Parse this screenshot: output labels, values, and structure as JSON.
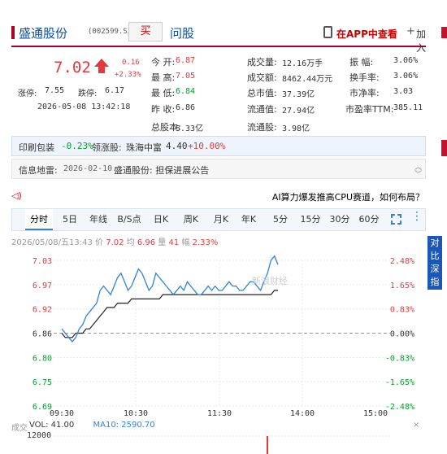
{
  "header": {
    "stock_name": "盛通股份",
    "stock_code": "(002599.SZ)",
    "buy_label": "买",
    "guba_label": "问股",
    "app_link": "在APP中查看",
    "add_label": "加入",
    "add_icon": "+"
  },
  "quote": {
    "price": "7.02",
    "change": "0.16",
    "change_pct": "+2.33%",
    "limit_up_label": "涨停:",
    "limit_up": "7.55",
    "limit_down_label": "跌停:",
    "limit_down": "6.17",
    "datetime": "2026-05-08 13:42:18",
    "fields": [
      {
        "label": "今    开:",
        "value": "6.87",
        "color": "red"
      },
      {
        "label": "最    高:",
        "value": "7.05",
        "color": "red"
      },
      {
        "label": "最    低:",
        "value": "6.84",
        "color": "green"
      },
      {
        "label": "昨    收:",
        "value": "6.86",
        "color": "normal"
      },
      {
        "label": "总股本:",
        "value": "5.33亿",
        "color": "normal"
      },
      {
        "label": "成交量:",
        "value": "12.16万手",
        "color": "normal"
      },
      {
        "label": "成交额:",
        "value": "8462.44万元",
        "color": "normal"
      },
      {
        "label": "总市值:",
        "value": "37.39亿",
        "color": "normal"
      },
      {
        "label": "流通值:",
        "value": "27.94亿",
        "color": "normal"
      },
      {
        "label": "流通股:",
        "value": "3.98亿",
        "color": "normal"
      },
      {
        "label": "振    幅:",
        "value": "3.06%",
        "color": "normal"
      },
      {
        "label": "换手率:",
        "value": "3.06%",
        "color": "normal"
      },
      {
        "label": "市净率:",
        "value": "3.03",
        "color": "normal"
      },
      {
        "label": "市盈率TTM:",
        "value": "385.11",
        "color": "normal"
      }
    ]
  },
  "industry": {
    "name": "印刷包装",
    "change": "-0.23%",
    "leader_label": "领涨股:",
    "leader_name": "珠海中富",
    "leader_price": "4.40",
    "leader_change": "+10.00%"
  },
  "news": {
    "label": "信息地雷:",
    "date": "2026-02-10",
    "title": "盛通股份: 担保进展公告",
    "chevron_up": "︿",
    "chevron_down": "﹀"
  },
  "ai_banner": "AI算力爆发推高CPU赛道，如何布局？",
  "speaker_icon": "◁)",
  "tabs": [
    "分时",
    "5日",
    "年线",
    "B/S点",
    "日K",
    "周K",
    "月K",
    "年K",
    "5分",
    "15分",
    "30分",
    "60分"
  ],
  "info_line": {
    "date": "2026/05/08/五13:43",
    "price_label": "价",
    "price": "7.02",
    "avg_label": "均",
    "avg": "6.96",
    "vol_label": "量",
    "vol": "41",
    "pct_label": "幅",
    "pct": "2.33%"
  },
  "float_button": "对比深指",
  "volume": {
    "label": "成交",
    "vol_text": "VOL: 41.00",
    "ma_text": "MA10: 2590.70",
    "max_label": "12000",
    "close_icon": "×"
  },
  "watermark": "新浪财经",
  "chart_data": {
    "type": "line",
    "y_left": [
      "7.03",
      "6.97",
      "6.92",
      "6.86",
      "6.80",
      "6.75",
      "6.69"
    ],
    "y_right": [
      "2.48%",
      "1.65%",
      "0.83%",
      "0.00%",
      "-0.83%",
      "-1.65%",
      "-2.48%"
    ],
    "x_labels": [
      "09:30",
      "10:30",
      "11:30",
      "14:00",
      "15:00"
    ],
    "ylim": [
      6.69,
      7.03
    ],
    "prev_close": 6.86,
    "series": [
      {
        "name": "价",
        "color": "#2f82d8",
        "values": [
          6.87,
          6.86,
          6.85,
          6.84,
          6.85,
          6.87,
          6.88,
          6.9,
          6.91,
          6.92,
          6.93,
          6.96,
          6.97,
          6.96,
          6.95,
          6.97,
          6.99,
          7.0,
          6.98,
          6.96,
          6.97,
          6.99,
          7.01,
          7.0,
          6.98,
          6.96,
          6.97,
          7.0,
          6.99,
          6.98,
          6.97,
          6.96,
          6.95,
          6.96,
          6.97,
          6.96,
          6.98,
          6.97,
          6.96,
          6.95,
          6.95,
          6.96,
          6.97,
          6.96,
          6.97,
          6.96,
          6.96,
          6.97,
          6.98,
          6.97,
          6.97,
          6.96,
          6.96,
          6.97,
          6.98,
          6.98,
          6.97,
          6.96,
          6.98,
          7.0,
          7.03,
          7.04,
          7.02
        ]
      },
      {
        "name": "均",
        "color": "#222222",
        "values": [
          6.86,
          6.85,
          6.85,
          6.85,
          6.86,
          6.86,
          6.86,
          6.87,
          6.87,
          6.88,
          6.89,
          6.9,
          6.91,
          6.92,
          6.92,
          6.92,
          6.93,
          6.93,
          6.93,
          6.93,
          6.94,
          6.94,
          6.94,
          6.94,
          6.94,
          6.94,
          6.94,
          6.94,
          6.94,
          6.95,
          6.95,
          6.95,
          6.95,
          6.95,
          6.95,
          6.95,
          6.95,
          6.95,
          6.95,
          6.95,
          6.95,
          6.95,
          6.95,
          6.95,
          6.95,
          6.95,
          6.95,
          6.95,
          6.95,
          6.95,
          6.95,
          6.95,
          6.95,
          6.95,
          6.95,
          6.95,
          6.95,
          6.95,
          6.95,
          6.95,
          6.95,
          6.96,
          6.96
        ]
      }
    ]
  }
}
